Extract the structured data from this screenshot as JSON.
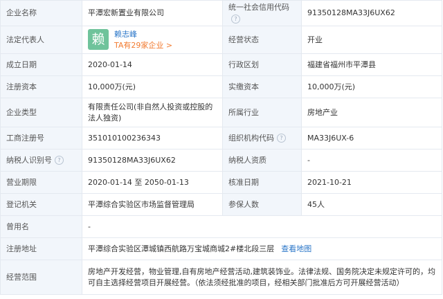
{
  "rows": [
    {
      "l1": "企业名称",
      "v1": "平潭宏新置业有限公司",
      "l2": "统一社会信用代码",
      "v2": "91350128MA33J6UX62"
    },
    {
      "l1": "法定代表人",
      "rep_char": "赖",
      "rep_name": "赖志峰",
      "rep_link": "TA有29家企业 >",
      "l2": "经营状态",
      "v2": "开业"
    },
    {
      "l1": "成立日期",
      "v1": "2020-01-14",
      "l2": "行政区划",
      "v2": "福建省福州市平潭县"
    },
    {
      "l1": "注册资本",
      "v1": "10,000万(元)",
      "l2": "实缴资本",
      "v2": "10,000万(元)"
    },
    {
      "l1": "企业类型",
      "v1": "有限责任公司(非自然人投资或控股的法人独资)",
      "l2": "所属行业",
      "v2": "房地产业"
    },
    {
      "l1": "工商注册号",
      "v1": "351010100236343",
      "l2": "组织机构代码",
      "v2": "MA33J6UX-6"
    },
    {
      "l1": "纳税人识别号",
      "v1": "91350128MA33J6UX62",
      "l2": "纳税人资质",
      "v2": "-"
    },
    {
      "l1": "营业期限",
      "v1": "2020-01-14 至 2050-01-13",
      "l2": "核准日期",
      "v2": "2021-10-21"
    },
    {
      "l1": "登记机关",
      "v1": "平潭综合实验区市场监督管理局",
      "l2": "参保人数",
      "v2": "45人"
    },
    {
      "l1": "曾用名",
      "v1": "-"
    },
    {
      "l1": "注册地址",
      "v1": "平潭综合实验区潭城镇西航路万宝城商城2#楼北段三层",
      "map_link": "查看地图"
    },
    {
      "l1": "经营范围",
      "v1": "房地产开发经营，物业管理,自有房地产经营活动,建筑装饰业。法律法规、国务院决定未规定许可的，均可自主选择经营项目开展经营。（依法须经批准的项目，经相关部门批准后方可开展经营活动）"
    }
  ],
  "hint_glyph": "?",
  "colors": {
    "label_bg": "#f2f6fb",
    "border": "#e4e9f0",
    "link": "#2a76c8",
    "orange": "#f27a2f",
    "avatar": "#6fc39b"
  }
}
